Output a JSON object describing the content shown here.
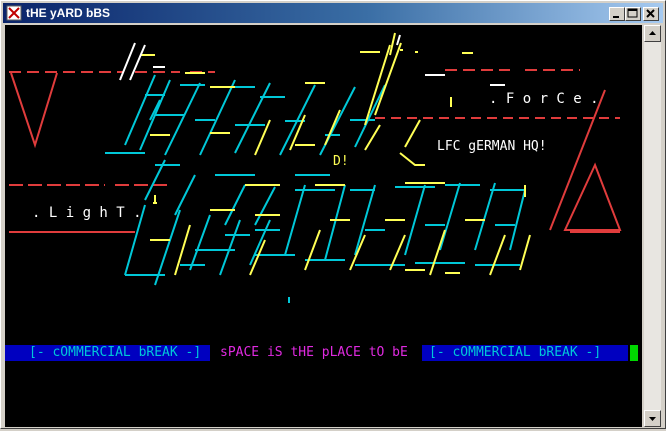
{
  "window": {
    "title": "tHE yARD bBS",
    "icon": "terminal-app-icon",
    "controls": [
      "minimize-icon",
      "maximize-icon",
      "close-icon"
    ]
  },
  "art": {
    "tagline_right": ". F o r C e .",
    "tagline_left": ". L i g h T .",
    "subtitle": "LFC gERMAN HQ!",
    "mark": "D!"
  },
  "status_bar": {
    "left_label": "[- cOMMERCIAL bREAK -]",
    "center_label": "sPACE iS tHE pLACE tO bE",
    "right_label": "[- cOMMERCIAL bREAK -]"
  },
  "colors": {
    "terminal_bg": "#000000",
    "cyan": "#00c8d8",
    "yellow": "#ffff55",
    "red": "#e03c3c",
    "white": "#ffffff",
    "blue_bar": "#0000c0",
    "magenta": "#e02ae0",
    "cursor": "#00d800"
  }
}
